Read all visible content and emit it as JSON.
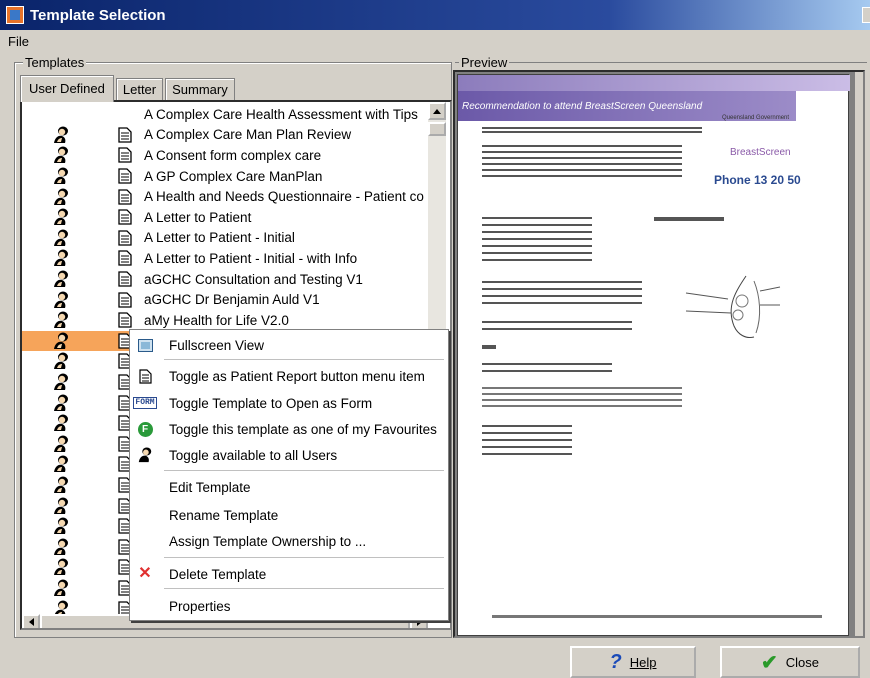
{
  "window": {
    "title": "Template Selection"
  },
  "menu": {
    "file": "File"
  },
  "groups": {
    "templates": "Templates",
    "preview": "Preview"
  },
  "tabs": [
    {
      "label": "User Defined",
      "active": true
    },
    {
      "label": "Letter",
      "active": false
    },
    {
      "label": "Summary",
      "active": false
    }
  ],
  "templates": [
    {
      "name": "A Complex Care Health Assessment with Tips",
      "user_icon": false,
      "doc_icon": false
    },
    {
      "name": "A Complex Care Man Plan Review",
      "user_icon": true,
      "doc_icon": true
    },
    {
      "name": "A Consent form complex care",
      "user_icon": true,
      "doc_icon": true
    },
    {
      "name": "A GP Complex Care ManPlan",
      "user_icon": true,
      "doc_icon": true
    },
    {
      "name": "A Health and Needs Questionnaire - Patient co",
      "user_icon": true,
      "doc_icon": true
    },
    {
      "name": "A Letter to Patient",
      "user_icon": true,
      "doc_icon": true
    },
    {
      "name": "A Letter to Patient - Initial",
      "user_icon": true,
      "doc_icon": true
    },
    {
      "name": "A Letter to Patient - Initial - with Info",
      "user_icon": true,
      "doc_icon": true
    },
    {
      "name": "aGCHC Consultation and Testing V1",
      "user_icon": true,
      "doc_icon": true
    },
    {
      "name": "aGCHC Dr Benjamin Auld V1",
      "user_icon": true,
      "doc_icon": true
    },
    {
      "name": "aMy Health for Life V2.0",
      "user_icon": true,
      "doc_icon": true
    }
  ],
  "context_menu": {
    "items": [
      {
        "label": "Fullscreen View",
        "icon": "fullscreen-icon"
      },
      {
        "label": "Toggle as Patient Report button menu item",
        "icon": "document-icon"
      },
      {
        "label": "Toggle Template to Open as Form",
        "icon": "form-icon"
      },
      {
        "label": "Toggle this template as one of my Favourites",
        "icon": "favourite-icon"
      },
      {
        "label": "Toggle available to all Users",
        "icon": "users-icon"
      },
      {
        "label": "Edit Template",
        "icon": ""
      },
      {
        "label": "Rename Template",
        "icon": ""
      },
      {
        "label": "Assign Template Ownership to ...",
        "icon": ""
      },
      {
        "label": "Delete Template",
        "icon": "delete-icon"
      },
      {
        "label": "Properties",
        "icon": ""
      }
    ],
    "form_badge": "FORM",
    "fav_badge": "F"
  },
  "preview": {
    "banner": "Recommendation to attend BreastScreen Queensland",
    "phone": "Phone 13 20 50",
    "brand": "BreastScreen",
    "gov": "Queensland Government"
  },
  "buttons": {
    "help": "Help",
    "close": "Close"
  },
  "colors": {
    "selection": "#f6a45a",
    "titlebar": "#0a246a",
    "delete": "#e03030",
    "fav": "#2a9a3a"
  }
}
